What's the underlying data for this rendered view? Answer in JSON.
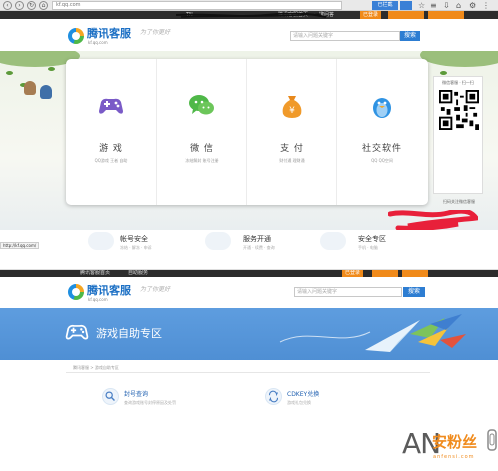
{
  "top": {
    "browser": {
      "address": "kf.qq.com",
      "tabs": [
        "已拦截",
        ""
      ]
    },
    "sitebar": {
      "center": "TN",
      "links": [
        "腾讯客服首页",
        "一键问答"
      ],
      "badge": "已登录"
    },
    "header": {
      "logo_name": "腾讯客服",
      "logo_url": "kf.qq.com",
      "slogan": "为了你更好",
      "search_placeholder": "请输入问题关键字",
      "search_button": "搜索"
    },
    "services": [
      {
        "label": "游 戏",
        "sub": "QQ游戏  王者  自助",
        "icon": "gamepad-icon"
      },
      {
        "label": "微 信",
        "sub": "冻结解封  账号注册",
        "icon": "wechat-icon"
      },
      {
        "label": "支 付",
        "sub": "财付通  理财通",
        "icon": "money-bag-icon"
      },
      {
        "label": "社交软件",
        "sub": "QQ  QQ空间",
        "icon": "penguin-icon"
      }
    ],
    "qr": {
      "title": "微信客服 · 扫一扫",
      "caption": "扫码关注微信客服"
    },
    "bottom_services": [
      {
        "label": "帐号安全",
        "sub": "冻结 · 解冻 · 申诉",
        "icon": "account-shield-icon"
      },
      {
        "label": "服务开通",
        "sub": "开通 · 续费 · 查询",
        "icon": "service-cloud-icon"
      },
      {
        "label": "安全专区",
        "sub": "手机 · 电脑",
        "icon": "security-cloud-icon"
      }
    ],
    "status_url": "http://kf.qq.com/"
  },
  "bottom": {
    "sitebar": {
      "links": [
        "腾讯客服首页",
        "自助服务"
      ],
      "badge": "已登录"
    },
    "header": {
      "logo_name": "腾讯客服",
      "logo_url": "kf.qq.com",
      "slogan": "为了你更好",
      "search_placeholder": "请输入问题关键字",
      "search_button": "搜索"
    },
    "banner": {
      "title": "游戏自助专区",
      "icon": "gamepad-icon"
    },
    "breadcrumb": "腾讯客服 > 游戏自助专区",
    "tiles": [
      {
        "label": "封号查询",
        "sub": "查询游戏账号封停原因及处罚",
        "icon": "search-icon"
      },
      {
        "label": "CDKEY兑换",
        "sub": "游戏礼包兑换",
        "icon": "exchange-icon"
      }
    ]
  },
  "watermark": {
    "brand": "AN",
    "cn": "安粉丝",
    "url": "anfensi.com"
  },
  "colors": {
    "brand_blue": "#2d7dd2",
    "banner_blue": "#5e9ddf",
    "orange": "#f08a1a",
    "wechat_green": "#4fb848",
    "redaction": "#e8203a"
  }
}
